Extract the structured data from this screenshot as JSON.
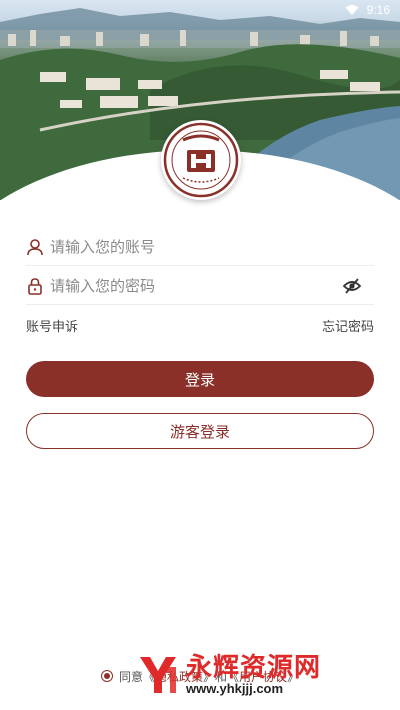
{
  "status_bar": {
    "time": "9:16",
    "wifi_icon": "wifi-icon"
  },
  "hero": {
    "image": "campus-aerial-photo"
  },
  "logo": {
    "seal_text": "湖北理工学院",
    "seal_subtext": "HUBEI POLYTECHNIC UNIVERSITY"
  },
  "account": {
    "icon": "user-icon",
    "placeholder": "请输入您的账号",
    "value": ""
  },
  "password": {
    "icon": "lock-icon",
    "placeholder": "请输入您的密码",
    "value": "",
    "toggle_icon": "eye-off-icon"
  },
  "links": {
    "appeal": "账号申诉",
    "forgot": "忘记密码"
  },
  "buttons": {
    "login": "登录",
    "guest": "游客登录"
  },
  "agreement": {
    "prefix": "同意《",
    "policy": "隐私政策",
    "mid": "》和《",
    "terms": "用户协议",
    "suffix": "》"
  },
  "watermark": {
    "title": "永辉资源网",
    "url": "www.yhkjjj.com"
  },
  "colors": {
    "brand": "#8a3029",
    "watermark": "#e02a2a"
  }
}
